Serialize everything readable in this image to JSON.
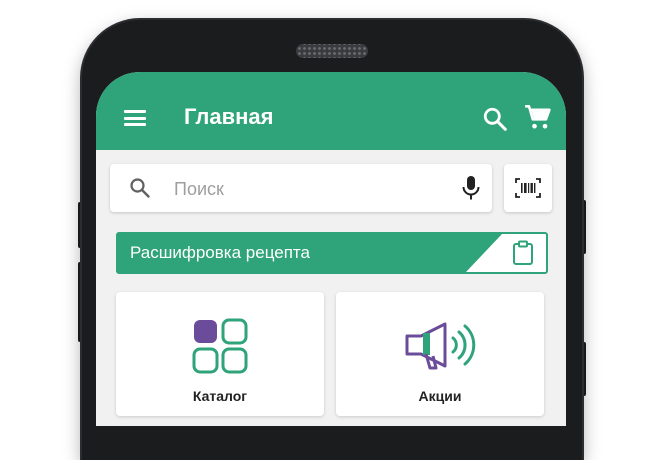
{
  "app": {
    "title": "Главная"
  },
  "search": {
    "placeholder": "Поиск",
    "value": ""
  },
  "recipe_banner": {
    "label": "Расшифровка рецепта"
  },
  "tiles": [
    {
      "label": "Каталог",
      "icon": "catalog-grid-icon"
    },
    {
      "label": "Акции",
      "icon": "megaphone-icon"
    }
  ],
  "colors": {
    "accent": "#2fa37a",
    "purple": "#6b4c9a",
    "background": "#f1f1f1"
  },
  "icons": {
    "menu": "hamburger-menu-icon",
    "search": "search-icon",
    "cart": "shopping-cart-icon",
    "mic": "microphone-icon",
    "barcode": "barcode-scanner-icon",
    "clipboard": "clipboard-icon"
  }
}
